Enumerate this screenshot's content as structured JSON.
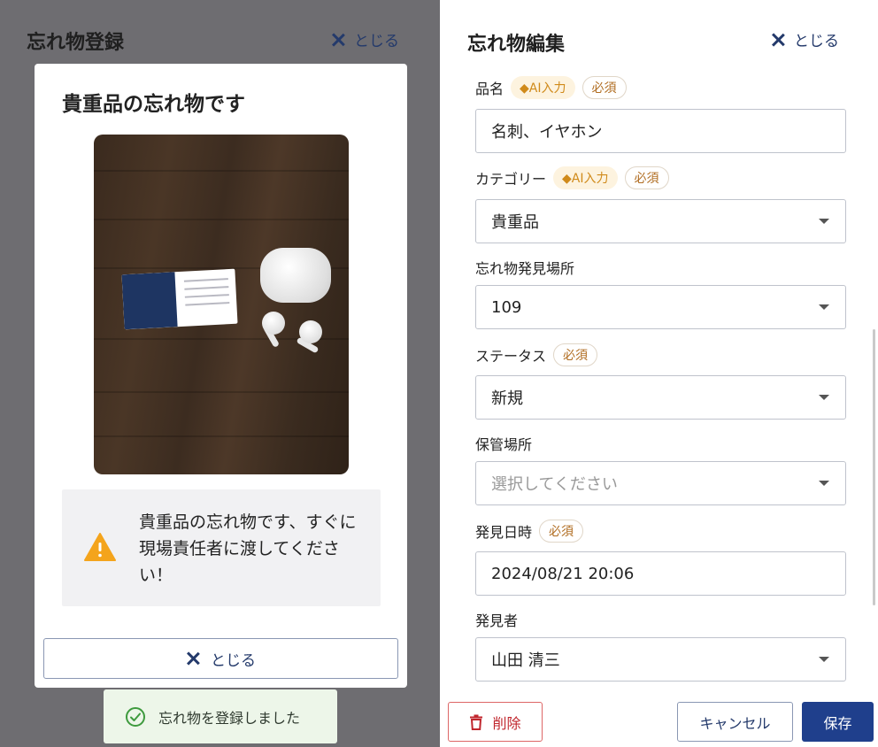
{
  "left": {
    "header_title": "忘れ物登録",
    "header_close_label": "とじる",
    "modal": {
      "title": "貴重品の忘れ物です",
      "warning_text": "貴重品の忘れ物です、すぐに現場責任者に渡してください！",
      "close_label": "とじる"
    },
    "toast": {
      "text": "忘れ物を登録しました"
    }
  },
  "right": {
    "title": "忘れ物編集",
    "close_label": "とじる",
    "badges": {
      "ai": "◆AI入力",
      "required": "必須"
    },
    "fields": {
      "item_name": {
        "label": "品名",
        "value": "名刺、イヤホン"
      },
      "category": {
        "label": "カテゴリー",
        "value": "貴重品"
      },
      "found_location": {
        "label": "忘れ物発見場所",
        "value": "109"
      },
      "status": {
        "label": "ステータス",
        "value": "新規"
      },
      "storage": {
        "label": "保管場所",
        "placeholder": "選択してください"
      },
      "found_datetime": {
        "label": "発見日時",
        "value": "2024/08/21 20:06"
      },
      "finder": {
        "label": "発見者",
        "value": "山田 清三"
      }
    },
    "buttons": {
      "delete": "削除",
      "cancel": "キャンセル",
      "save": "保存"
    }
  },
  "colors": {
    "accent": "#1f3f8c",
    "link": "#243a6b",
    "danger": "#c0262d",
    "warning": "#f4a41c",
    "success": "#3e9a3e",
    "ai_badge": "#d08a1a"
  }
}
